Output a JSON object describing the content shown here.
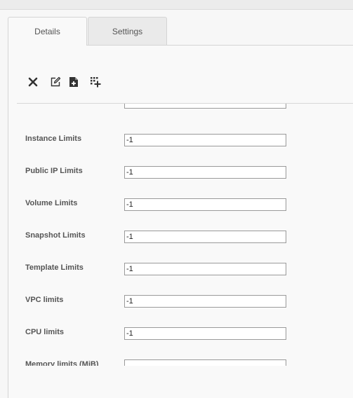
{
  "tabs": [
    {
      "label": "Details",
      "active": true
    },
    {
      "label": "Settings",
      "active": false
    }
  ],
  "toolbar": {
    "icons": [
      "remove-icon",
      "edit-icon",
      "add-document-icon",
      "add-grid-icon"
    ]
  },
  "limits": [
    {
      "label": "Instance Limits",
      "value": "-1"
    },
    {
      "label": "Public IP Limits",
      "value": "-1"
    },
    {
      "label": "Volume Limits",
      "value": "-1"
    },
    {
      "label": "Snapshot Limits",
      "value": "-1"
    },
    {
      "label": "Template Limits",
      "value": "-1"
    },
    {
      "label": "VPC limits",
      "value": "-1"
    },
    {
      "label": "CPU limits",
      "value": "-1"
    },
    {
      "label": "Memory limits (MiB)",
      "value": ""
    }
  ]
}
